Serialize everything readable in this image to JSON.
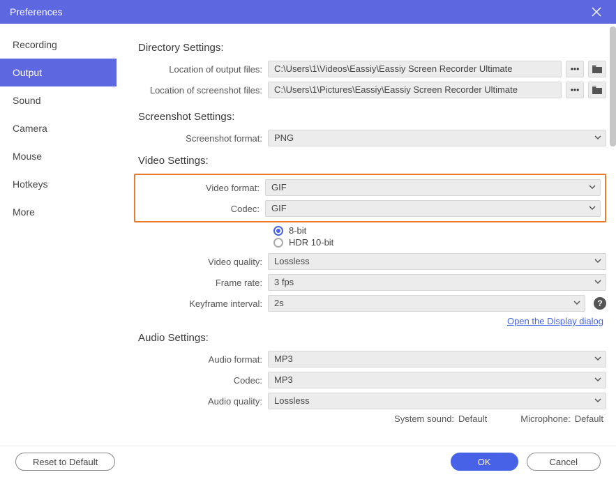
{
  "window": {
    "title": "Preferences"
  },
  "sidebar": {
    "items": [
      {
        "label": "Recording"
      },
      {
        "label": "Output",
        "active": true
      },
      {
        "label": "Sound"
      },
      {
        "label": "Camera"
      },
      {
        "label": "Mouse"
      },
      {
        "label": "Hotkeys"
      },
      {
        "label": "More"
      }
    ]
  },
  "sections": {
    "directory": {
      "title": "Directory Settings:",
      "output_label": "Location of output files:",
      "output_value": "C:\\Users\\1\\Videos\\Eassiy\\Eassiy Screen Recorder Ultimate",
      "screenshot_label": "Location of screenshot files:",
      "screenshot_value": "C:\\Users\\1\\Pictures\\Eassiy\\Eassiy Screen Recorder Ultimate"
    },
    "screenshot": {
      "title": "Screenshot Settings:",
      "format_label": "Screenshot format:",
      "format_value": "PNG"
    },
    "video": {
      "title": "Video Settings:",
      "format_label": "Video format:",
      "format_value": "GIF",
      "codec_label": "Codec:",
      "codec_value": "GIF",
      "bit_option_8": "8-bit",
      "bit_option_hdr": "HDR 10-bit",
      "quality_label": "Video quality:",
      "quality_value": "Lossless",
      "framerate_label": "Frame rate:",
      "framerate_value": "3 fps",
      "keyframe_label": "Keyframe interval:",
      "keyframe_value": "2s",
      "display_link": "Open the Display dialog"
    },
    "audio": {
      "title": "Audio Settings:",
      "format_label": "Audio format:",
      "format_value": "MP3",
      "codec_label": "Codec:",
      "codec_value": "MP3",
      "quality_label": "Audio quality:",
      "quality_value": "Lossless",
      "system_sound_label": "System sound:",
      "system_sound_value": "Default",
      "microphone_label": "Microphone:",
      "microphone_value": "Default"
    }
  },
  "footer": {
    "reset": "Reset to Default",
    "ok": "OK",
    "cancel": "Cancel"
  }
}
